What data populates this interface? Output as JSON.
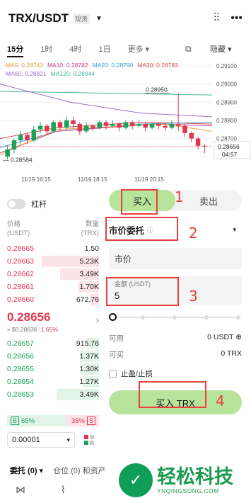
{
  "header": {
    "pair": "TRX/USDT",
    "tag": "现货",
    "caret": "▼",
    "icon_chart": "⫶⫶",
    "icon_more": "•••"
  },
  "timeframes": [
    "15分",
    "1时",
    "4时",
    "1日",
    "更多 ▾"
  ],
  "tf_active_index": 0,
  "tf_settings_icon": "⧉",
  "tf_hide": "隐藏 ▾",
  "ma": [
    {
      "label": "MA5: 0.28743",
      "color": "#e9a23b"
    },
    {
      "label": "MA10: 0.28782",
      "color": "#c9408f"
    },
    {
      "label": "MA20: 0.28790",
      "color": "#3ba3d8"
    },
    {
      "label": "MA30: 0.28783",
      "color": "#d94b4b"
    },
    {
      "label": "MA60: 0.28821",
      "color": "#9a6fd0"
    },
    {
      "label": "MA120: 0.28944",
      "color": "#46b39a"
    }
  ],
  "chart_data": {
    "type": "candlestick",
    "price_ticks": [
      "0.29100",
      "0.29000",
      "0.28900",
      "0.28800",
      "0.28700"
    ],
    "time_ticks": [
      "11/19 16:15",
      "11/19 18:15",
      "11/19 20:15"
    ],
    "high_label": "0.28950",
    "low_label": "0.28584",
    "current_price": "0.28656",
    "countdown": "04:57",
    "candles": [
      {
        "o": 0.286,
        "c": 0.2864,
        "h": 0.2866,
        "l": 0.28584
      },
      {
        "o": 0.2864,
        "c": 0.2869,
        "h": 0.287,
        "l": 0.2862
      },
      {
        "o": 0.2869,
        "c": 0.2872,
        "h": 0.2874,
        "l": 0.2867
      },
      {
        "o": 0.2872,
        "c": 0.2869,
        "h": 0.2873,
        "l": 0.2867
      },
      {
        "o": 0.2869,
        "c": 0.2875,
        "h": 0.2877,
        "l": 0.2868
      },
      {
        "o": 0.2875,
        "c": 0.2877,
        "h": 0.2879,
        "l": 0.2873
      },
      {
        "o": 0.2877,
        "c": 0.2874,
        "h": 0.2878,
        "l": 0.2872
      },
      {
        "o": 0.2874,
        "c": 0.2879,
        "h": 0.288,
        "l": 0.2873
      },
      {
        "o": 0.2879,
        "c": 0.2876,
        "h": 0.288,
        "l": 0.2874
      },
      {
        "o": 0.2876,
        "c": 0.288,
        "h": 0.2882,
        "l": 0.2875
      },
      {
        "o": 0.288,
        "c": 0.2878,
        "h": 0.2882,
        "l": 0.2876
      },
      {
        "o": 0.2878,
        "c": 0.2874,
        "h": 0.2879,
        "l": 0.2872
      },
      {
        "o": 0.2874,
        "c": 0.2877,
        "h": 0.2879,
        "l": 0.2873
      },
      {
        "o": 0.2877,
        "c": 0.2876,
        "h": 0.2878,
        "l": 0.2874
      },
      {
        "o": 0.2876,
        "c": 0.2879,
        "h": 0.288,
        "l": 0.2875
      },
      {
        "o": 0.2879,
        "c": 0.2877,
        "h": 0.288,
        "l": 0.2875
      },
      {
        "o": 0.2877,
        "c": 0.2878,
        "h": 0.288,
        "l": 0.2876
      },
      {
        "o": 0.2878,
        "c": 0.2876,
        "h": 0.2879,
        "l": 0.2874
      },
      {
        "o": 0.2876,
        "c": 0.2879,
        "h": 0.288,
        "l": 0.2875
      },
      {
        "o": 0.2879,
        "c": 0.2877,
        "h": 0.288,
        "l": 0.2875
      },
      {
        "o": 0.2877,
        "c": 0.2878,
        "h": 0.288,
        "l": 0.2876
      },
      {
        "o": 0.2878,
        "c": 0.2876,
        "h": 0.2879,
        "l": 0.2874
      },
      {
        "o": 0.2876,
        "c": 0.2878,
        "h": 0.2879,
        "l": 0.2875
      },
      {
        "o": 0.2878,
        "c": 0.2877,
        "h": 0.2879,
        "l": 0.2875
      },
      {
        "o": 0.2877,
        "c": 0.2876,
        "h": 0.2879,
        "l": 0.2874
      },
      {
        "o": 0.2876,
        "c": 0.2878,
        "h": 0.288,
        "l": 0.2875
      },
      {
        "o": 0.2878,
        "c": 0.2877,
        "h": 0.2895,
        "l": 0.2874
      },
      {
        "o": 0.2877,
        "c": 0.2873,
        "h": 0.2878,
        "l": 0.2871
      },
      {
        "o": 0.2873,
        "c": 0.287,
        "h": 0.2874,
        "l": 0.2868
      },
      {
        "o": 0.287,
        "c": 0.2866,
        "h": 0.2871,
        "l": 0.2864
      },
      {
        "o": 0.2866,
        "c": 0.28656,
        "h": 0.2867,
        "l": 0.2862
      }
    ]
  },
  "leverage_label": "杠杆",
  "ob_header": {
    "price": "价格",
    "price_unit": "(USDT)",
    "qty": "数量",
    "qty_unit": "(TRX)"
  },
  "asks": [
    {
      "p": "0.28665",
      "q": "1.50",
      "depth": 0.0
    },
    {
      "p": "0.28663",
      "q": "5.23K",
      "depth": 0.62
    },
    {
      "p": "0.28662",
      "q": "3.49K",
      "depth": 0.42
    },
    {
      "p": "0.28661",
      "q": "1.70K",
      "depth": 0.22
    },
    {
      "p": "0.28660",
      "q": "672.76",
      "depth": 0.1
    }
  ],
  "last": {
    "price": "0.28656",
    "usd": "≈ $0.28636",
    "change": "-1.65%",
    "arrow": "›"
  },
  "bids": [
    {
      "p": "0.28657",
      "q": "915.76",
      "depth": 0.13
    },
    {
      "p": "0.28656",
      "q": "1.37K",
      "depth": 0.2
    },
    {
      "p": "0.28655",
      "q": "1.30K",
      "depth": 0.19
    },
    {
      "p": "0.28654",
      "q": "1.27K",
      "depth": 0.18
    },
    {
      "p": "0.28653",
      "q": "3.49K",
      "depth": 0.46
    }
  ],
  "ratio": {
    "b_tag": "B",
    "b_pct": "65%",
    "s_pct": "35%",
    "s_tag": "S",
    "b_frac": 0.65
  },
  "precision": {
    "value": "0.00001",
    "caret": "▾"
  },
  "form": {
    "buy_tab": "买入",
    "sell_tab": "卖出",
    "order_type": "市价委托",
    "order_info": "ⓘ",
    "order_caret": "▾",
    "price_placeholder": "市价",
    "amount_label": "金额 (USDT)",
    "amount_value": "5",
    "slider_level": 0.0,
    "available_label": "可用",
    "available_value": "0 USDT ⊕",
    "canbuy_label": "可买",
    "canbuy_value": "0 TRX",
    "tpsl_label": "止盈/止损",
    "buy_button": "买入 TRX"
  },
  "annotations": [
    "1",
    "2",
    "3",
    "4"
  ],
  "bottom_tabs": [
    "委托 (0) ▾",
    "仓位 (0) 和资产"
  ],
  "bottom_nav_icons": [
    "⋈",
    "⌇"
  ],
  "watermark": {
    "title": "轻松科技",
    "sub": "YNQINGSONG.COM"
  }
}
